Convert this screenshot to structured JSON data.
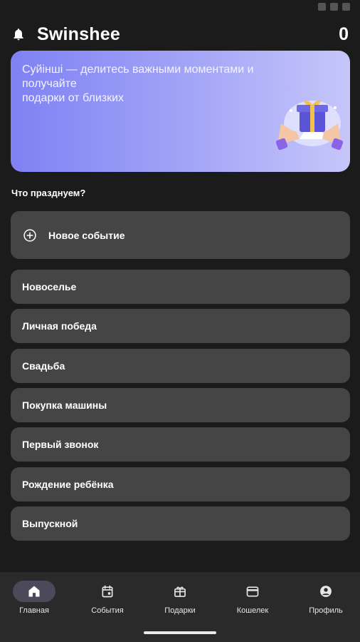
{
  "header": {
    "title": "Swinshee",
    "counter": "0"
  },
  "banner": {
    "line1": "Суйінші — делитесь важными моментами и",
    "line2": "получайте",
    "line3": "подарки от близких"
  },
  "section_label": "Что празднуем?",
  "new_event_label": "Новое событие",
  "events": [
    "Новоселье",
    "Личная победа",
    "Свадьба",
    "Покупка машины",
    "Первый звонок",
    "Рождение ребёнка",
    "Выпускной"
  ],
  "nav": [
    {
      "label": "Главная",
      "icon": "home-icon",
      "active": true
    },
    {
      "label": "События",
      "icon": "calendar-icon",
      "active": false
    },
    {
      "label": "Подарки",
      "icon": "gift-icon",
      "active": false
    },
    {
      "label": "Кошелек",
      "icon": "wallet-icon",
      "active": false
    },
    {
      "label": "Профиль",
      "icon": "profile-icon",
      "active": false
    }
  ],
  "colors": {
    "background": "#1b1b1b",
    "card": "#454545",
    "banner_start": "#7f81f4",
    "banner_end": "#c6c6fa",
    "nav_bar": "#2a2a2a",
    "nav_active_pill": "#4b4a5a"
  }
}
